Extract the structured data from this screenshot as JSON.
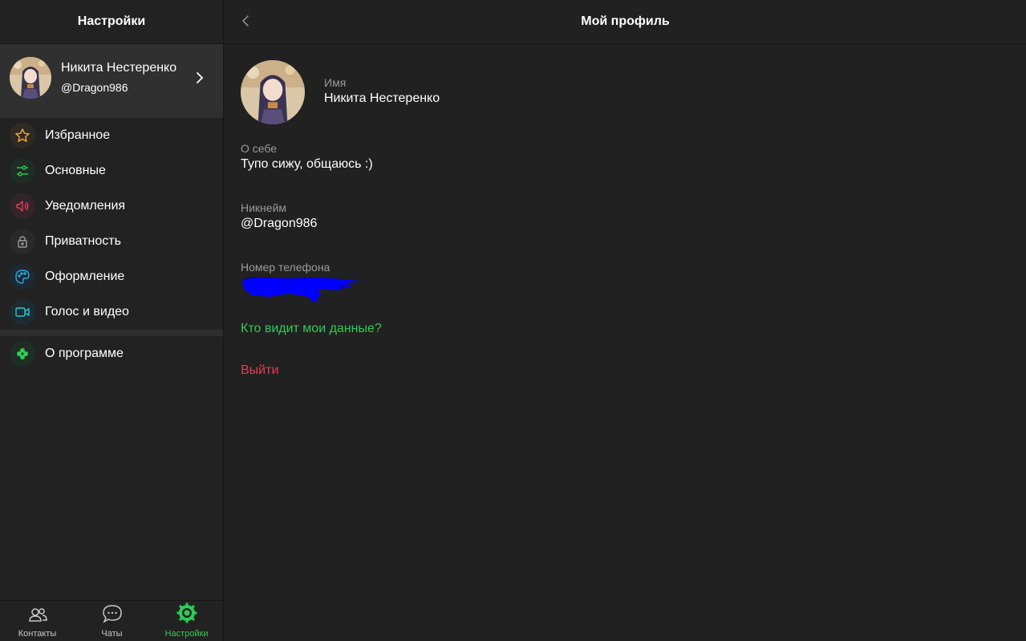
{
  "sidebar": {
    "title": "Настройки",
    "profile": {
      "name": "Никита Нестеренко",
      "nickname": "@Dragon986"
    },
    "menu": [
      {
        "label": "Избранное",
        "icon": "star-icon",
        "color": "#e8a03a"
      },
      {
        "label": "Основные",
        "icon": "sliders-icon",
        "color": "#2ecc55"
      },
      {
        "label": "Уведомления",
        "icon": "speaker-icon",
        "color": "#e53a5a"
      },
      {
        "label": "Приватность",
        "icon": "lock-icon",
        "color": "#9a9a9a"
      },
      {
        "label": "Оформление",
        "icon": "palette-icon",
        "color": "#2aa8e0"
      },
      {
        "label": "Голос и видео",
        "icon": "video-icon",
        "color": "#26c6da"
      }
    ],
    "about": {
      "label": "О программе",
      "icon": "clover-icon",
      "color": "#2ecc55"
    }
  },
  "bottom_nav": {
    "tabs": [
      {
        "label": "Контакты",
        "icon": "contacts-icon",
        "active": false
      },
      {
        "label": "Чаты",
        "icon": "chat-bubble-icon",
        "active": false
      },
      {
        "label": "Настройки",
        "icon": "settings-gear-icon",
        "active": true
      }
    ],
    "active_color": "#2ecc55"
  },
  "main": {
    "title": "Мой профиль",
    "name_label": "Имя",
    "name_value": "Никита Нестеренко",
    "about_label": "О себе",
    "about_value": "Тупо сижу, общаюсь :)",
    "nick_label": "Никнейм",
    "nick_value": "@Dragon986",
    "phone_label": "Номер телефона",
    "privacy_link": "Кто видит мои данные?",
    "logout": "Выйти"
  },
  "colors": {
    "background": "#212121",
    "accent_green": "#2ecc55",
    "danger_red": "#e53a5a",
    "redaction_blue": "#0000ff"
  }
}
